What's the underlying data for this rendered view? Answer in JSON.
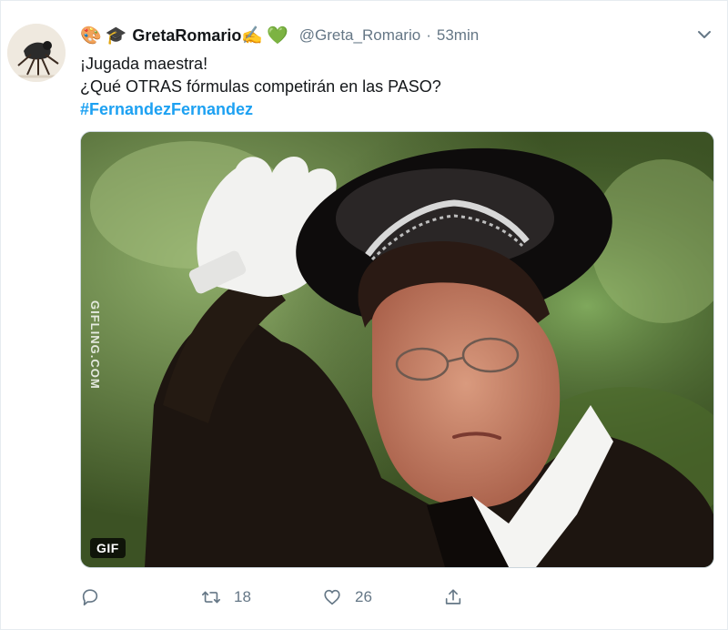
{
  "tweet": {
    "header": {
      "emojis": [
        "🎨",
        "🎓"
      ],
      "display_name": "GretaRomario",
      "name_emojis": [
        "✍️",
        "💚"
      ],
      "handle": "@Greta_Romario",
      "separator": "·",
      "time": "53min"
    },
    "text": {
      "line1": "¡Jugada maestra!",
      "line2": "¿Qué OTRAS fórmulas competirán en las PASO?",
      "hashtag": "#FernandezFernandez"
    },
    "media": {
      "badge": "GIF",
      "watermark": "GIFLING.COM"
    },
    "actions": {
      "reply_count": "",
      "retweet_count": "18",
      "like_count": "26"
    },
    "colors": {
      "link": "#1da1f2",
      "secondary": "#657786",
      "text": "#14171a"
    }
  }
}
